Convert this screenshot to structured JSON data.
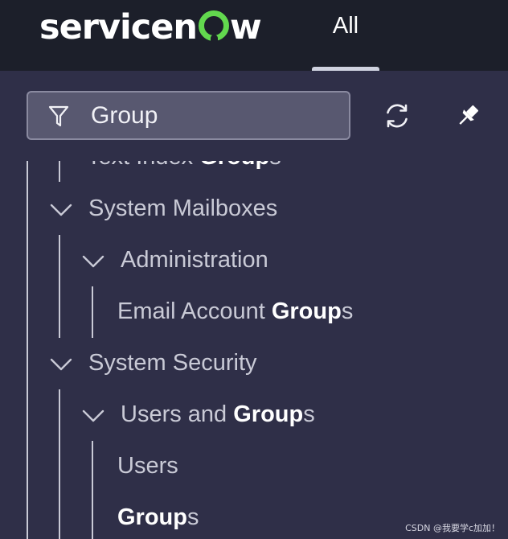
{
  "header": {
    "logo_text": "servicenow",
    "all_tab_label": "All"
  },
  "filter": {
    "value": "Group"
  },
  "tree": {
    "items": [
      {
        "prefix": "Text Index ",
        "match": "Group",
        "suffix": "s",
        "expanded": null
      },
      {
        "prefix": "System Mailboxes",
        "match": "",
        "suffix": "",
        "expanded": true
      },
      {
        "prefix": "Administration",
        "match": "",
        "suffix": "",
        "expanded": true
      },
      {
        "prefix": "Email Account ",
        "match": "Group",
        "suffix": "s",
        "expanded": null
      },
      {
        "prefix": "System Security",
        "match": "",
        "suffix": "",
        "expanded": true
      },
      {
        "prefix": "Users and ",
        "match": "Group",
        "suffix": "s",
        "expanded": true
      },
      {
        "prefix": "Users",
        "match": "",
        "suffix": "",
        "expanded": null
      },
      {
        "prefix": "",
        "match": "Group",
        "suffix": "s",
        "expanded": null
      }
    ]
  },
  "watermark": "CSDN @我要学c加加！",
  "colors": {
    "topbar": "#1c1f2a",
    "panel": "#2f2f48",
    "accent": "#62d84e",
    "match_text": "#ffffff"
  },
  "icons": [
    "filter-icon",
    "refresh-icon",
    "pin-icon",
    "chevron-down-icon"
  ]
}
